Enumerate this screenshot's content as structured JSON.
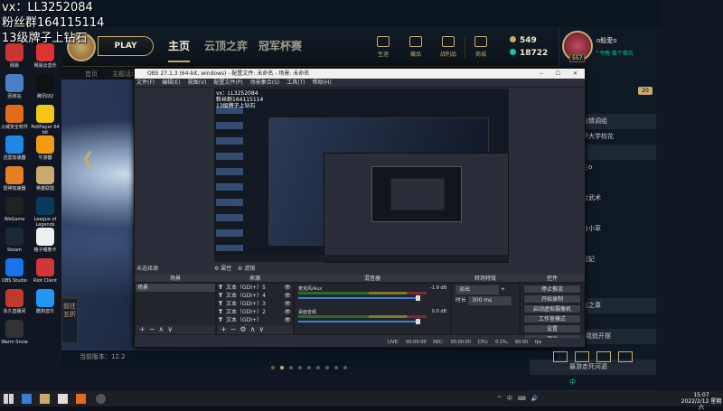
{
  "overlay": {
    "line1": "vx：LL3252084",
    "line2": "粉丝群164115114",
    "line3": "13级牌子上钻石"
  },
  "desktop_icons": [
    {
      "label": "网易",
      "color": "#c33"
    },
    {
      "label": "网易云音乐",
      "color": "#d33"
    },
    {
      "label": "回收站",
      "color": "#4a7fc4"
    },
    {
      "label": "腾讯QQ",
      "color": "#111"
    },
    {
      "label": "火绒安全软件",
      "color": "#e36c1a"
    },
    {
      "label": "PotPlayer 64 bit",
      "color": "#f5c518"
    },
    {
      "label": "迅雷加速器",
      "color": "#1e88e5"
    },
    {
      "label": "牛游器",
      "color": "#f39c12"
    },
    {
      "label": "雷神加速器",
      "color": "#e67e22"
    },
    {
      "label": "英雄联盟",
      "color": "#c8aa6e"
    },
    {
      "label": "WeGame",
      "color": "#222"
    },
    {
      "label": "League of Legends",
      "color": "#0a3a5a"
    },
    {
      "label": "Steam",
      "color": "#1b2838"
    },
    {
      "label": "格子喵春卡",
      "color": "#eee"
    },
    {
      "label": "OBS Studio",
      "color": "#1a73e8"
    },
    {
      "label": "Riot Client",
      "color": "#d13639"
    },
    {
      "label": "永久直播间",
      "color": "#c0392b"
    },
    {
      "label": "酷狗音乐",
      "color": "#2196f3"
    },
    {
      "label": "Warm Snow",
      "color": "#333"
    }
  ],
  "lol": {
    "play_label": "PLAY",
    "tabs": [
      "主页",
      "云顶之弈",
      "冠军杯赛"
    ],
    "top_icons": [
      "生涯",
      "藏品",
      "战利品",
      "商城"
    ],
    "currency_be": "549",
    "currency_rp": "18722",
    "subnav": [
      "首页",
      "主题活动"
    ],
    "side_label": "前往五折",
    "version": "当前版本：12.2",
    "carousel_count": 9,
    "carousel_active": 1
  },
  "social": {
    "name": "o鲶愛o",
    "status": "^今晚 敬个梯坑",
    "level": "557",
    "badge": "20",
    "friends": [
      "文元向情调组",
      "想深罗大学校花",
      "中",
      "吞公主o",
      "",
      "专业会武术",
      "",
      "南仍自小草",
      "",
      "小姐妮妃",
      "",
      "(18)",
      "凡九五之尊",
      "",
      "原pin我就开摆",
      "",
      "最游走死河遁",
      "中",
      "mate：许兮"
    ]
  },
  "obs": {
    "title": "OBS 27.1.3 (64-bit, windows) - 配置文件: 未命名 - 场景: 未命名",
    "menu": [
      "文件(F)",
      "编辑(E)",
      "视图(V)",
      "配置文件(P)",
      "场景集合(S)",
      "工具(T)",
      "帮助(H)"
    ],
    "preview_overlay": [
      "vx：LL3252084",
      "粉丝群164115114",
      "13级牌子上钻石"
    ],
    "docks": {
      "scenes_title": "场景",
      "sources_title": "来源",
      "mixer_title": "混音器",
      "transitions_title": "转场特效",
      "controls_title": "控件"
    },
    "no_source_label": "未选择源",
    "props_label": "属性",
    "filters_label": "滤镜",
    "scenes": [
      "场景"
    ],
    "sources": [
      "文本（GDI+）5",
      "文本（GDI+）4",
      "文本（GDI+）3",
      "文本（GDI+）2",
      "文本（GDI+）",
      "显示器采集"
    ],
    "mixer": [
      {
        "name": "麦克风/Aux",
        "db": "-1.9 dB"
      },
      {
        "name": "桌面音频",
        "db": "0.0 dB"
      }
    ],
    "transition": {
      "type": "淡出",
      "duration_label": "时长",
      "duration": "300 ms"
    },
    "controls": [
      "停止推流",
      "开始录制",
      "启动虚拟摄像机",
      "工作室模式",
      "设置",
      "退出"
    ],
    "status": [
      "LIVE: 00:00:00",
      "REC: 00:00:00",
      "CPU: 0.1%, 60.00 fps"
    ]
  },
  "taskbar": {
    "time": "15:07",
    "date": "2022/2/12 星期六",
    "tray": [
      "^",
      "中",
      "⌨",
      "🔊"
    ]
  }
}
